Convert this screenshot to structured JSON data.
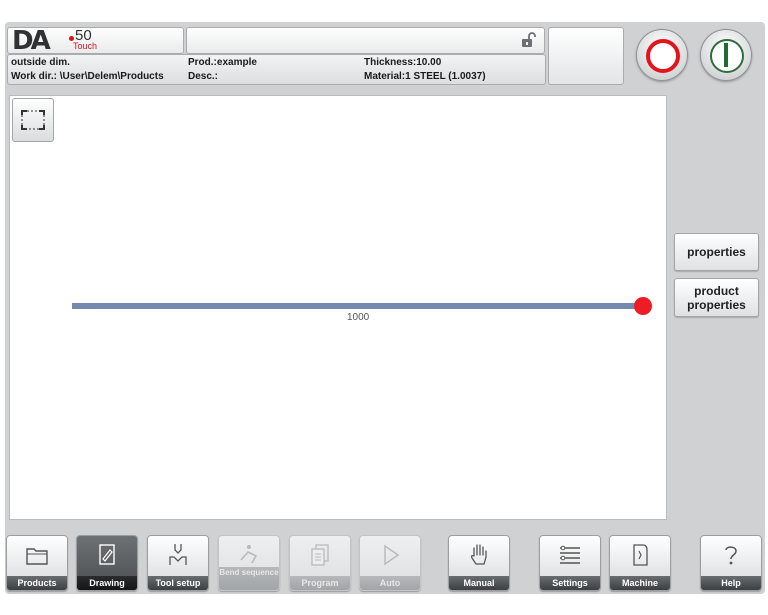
{
  "header": {
    "logo": {
      "brand": "DA",
      "model": "50",
      "suffix": "Touch"
    },
    "message": "",
    "info": {
      "mode": "outside dim.",
      "work_dir": "Work dir.: \\User\\Delem\\Products",
      "product": "Prod.:example",
      "description": "Desc.:",
      "thickness": "Thickness:10.00",
      "material": "Material:1 STEEL (1.0037)"
    }
  },
  "controls": {
    "stop_icon": "stop-icon",
    "start_icon": "start-icon"
  },
  "drawing": {
    "dimension_label": "1000",
    "line_color": "#7588ad",
    "endpoint_color": "#ee1c24"
  },
  "side_buttons": {
    "properties": "properties",
    "product_properties_line1": "product",
    "product_properties_line2": "properties"
  },
  "tabs": [
    {
      "label": "Products",
      "icon": "folder-icon",
      "state": "normal"
    },
    {
      "label": "Drawing",
      "icon": "drawing-icon",
      "state": "active"
    },
    {
      "label": "Tool setup",
      "icon": "tool-icon",
      "state": "normal"
    },
    {
      "label": "Bend sequence",
      "icon": "bend-icon",
      "state": "disabled"
    },
    {
      "label": "Program",
      "icon": "program-icon",
      "state": "disabled"
    },
    {
      "label": "Auto",
      "icon": "play-icon",
      "state": "disabled"
    },
    {
      "label": "Manual",
      "icon": "hand-icon",
      "state": "normal"
    },
    {
      "label": "Settings",
      "icon": "settings-icon",
      "state": "normal"
    },
    {
      "label": "Machine",
      "icon": "machine-icon",
      "state": "normal"
    },
    {
      "label": "Help",
      "icon": "help-icon",
      "state": "normal"
    }
  ]
}
